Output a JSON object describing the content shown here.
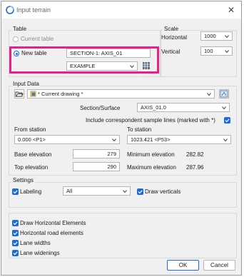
{
  "window": {
    "title": "Input terrain",
    "close_glyph": "✕"
  },
  "table": {
    "group_label": "Table",
    "current_table_label": "Current table",
    "new_table_label": "New table",
    "new_table_value": "SECTION-1: AXIS_01",
    "style_value": "EXAMPLE"
  },
  "scale": {
    "group_label": "Scale",
    "horizontal_label": "Horizontal",
    "horizontal_value": "1000",
    "vertical_label": "Vertical",
    "vertical_value": "100"
  },
  "input_data": {
    "group_label": "Input Data",
    "drawing_value": "* Current drawing *",
    "section_surface_label": "Section/Surface",
    "section_surface_value": "AXIS_01.0",
    "include_label": "Include correspondent sample lines (marked with *)",
    "from_station_label": "From station",
    "from_station_value": "0.000 <P1>",
    "to_station_label": "To station",
    "to_station_value": "1023.421 <P53>",
    "base_elevation_label": "Base elevation",
    "base_elevation_value": "279",
    "top_elevation_label": "Top elevation",
    "top_elevation_value": "290",
    "min_elevation_label": "Minimum elevation",
    "min_elevation_value": "282.82",
    "max_elevation_label": "Maximum elevation",
    "max_elevation_value": "287.96"
  },
  "settings": {
    "group_label": "Settings",
    "labeling_label": "Labeling",
    "labeling_value": "All",
    "draw_verticals_label": "Draw verticals"
  },
  "elements": {
    "draw_horizontal_label": "Draw Horizontal Elements",
    "horizontal_road_label": "Horizontal road elements",
    "lane_widths_label": "Lane widths",
    "lane_widenings_label": "Lane widenings"
  },
  "buttons": {
    "ok": "OK",
    "cancel": "Cancel"
  },
  "colors": {
    "accent": "#1e6ad8",
    "highlight": "#e8208a"
  }
}
